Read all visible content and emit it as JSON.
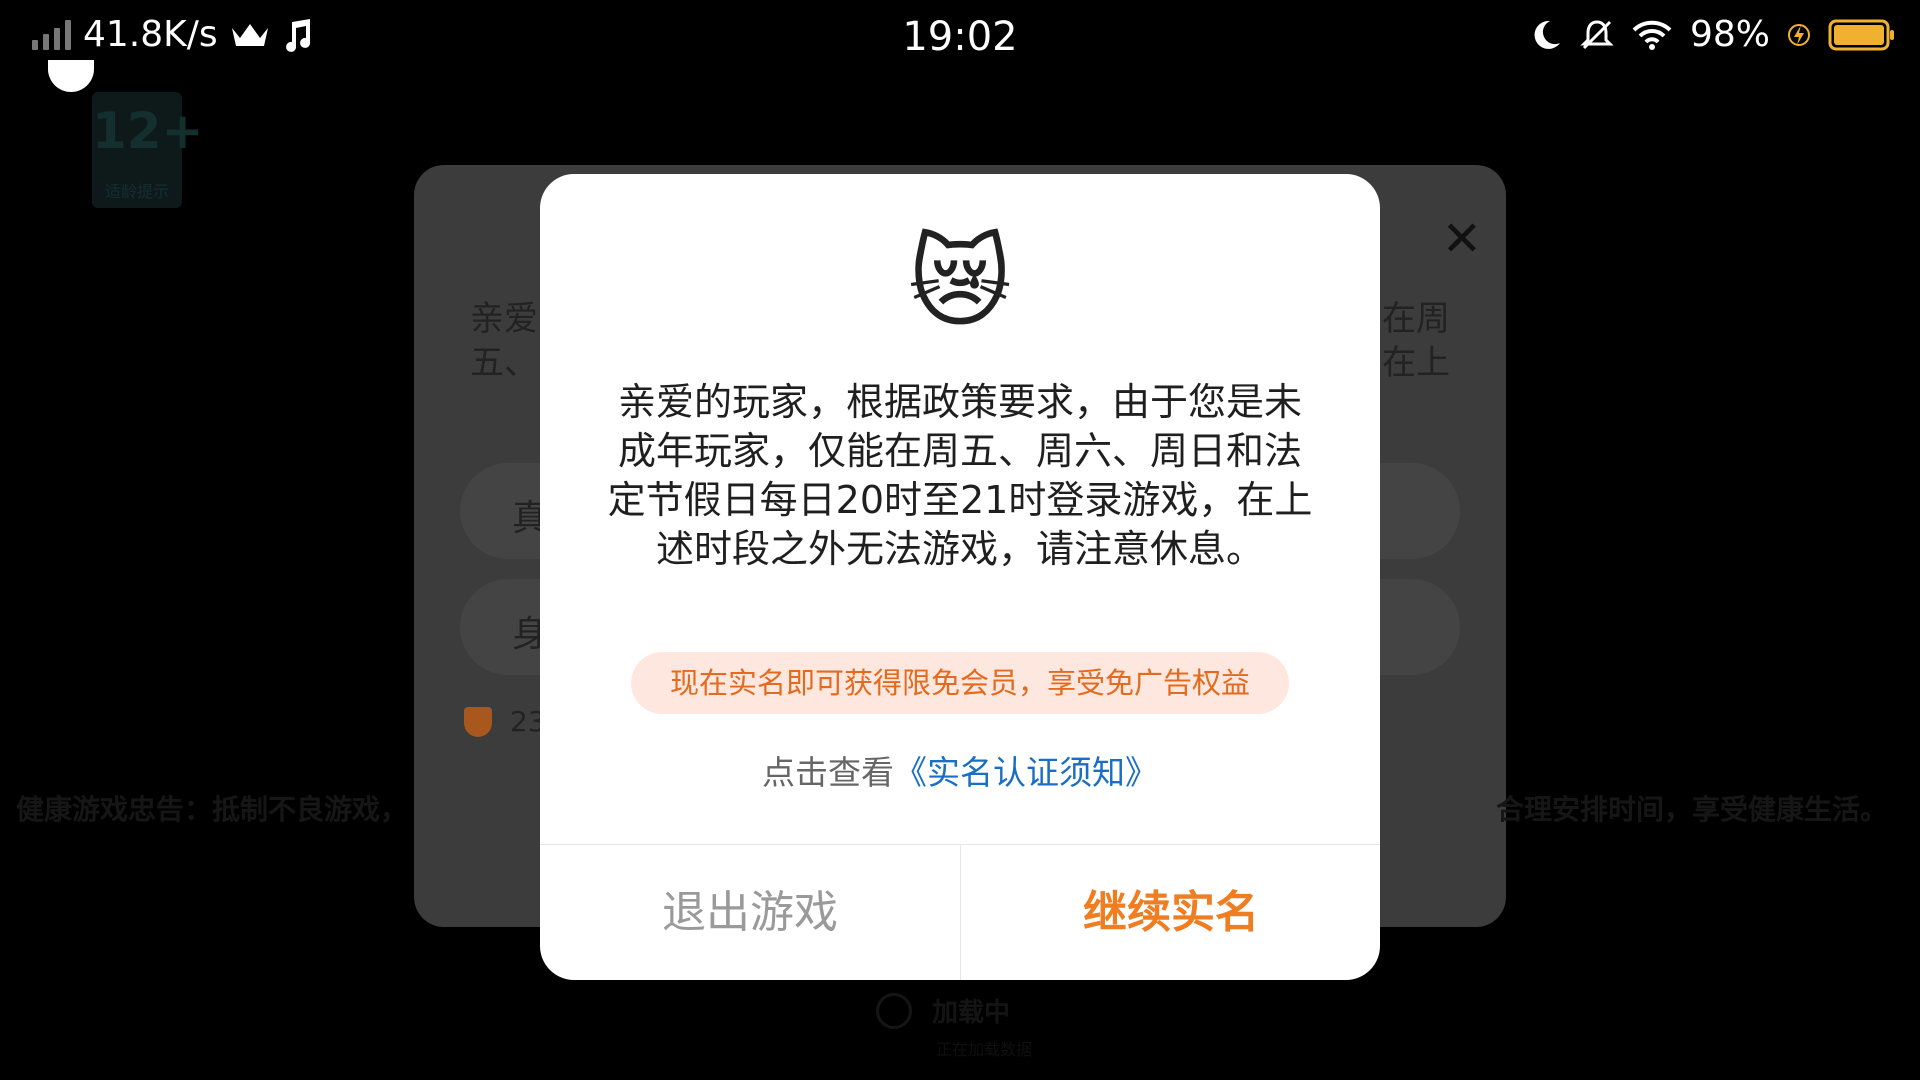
{
  "status_bar": {
    "speed": "41.8K/s",
    "time": "19:02",
    "battery": "98%",
    "icons": [
      "signal-icon",
      "crown-icon",
      "music-note-icon",
      "moon-icon",
      "muted-bell-icon",
      "wifi-icon",
      "charging-bolt-icon",
      "battery-icon"
    ]
  },
  "age_badge": {
    "rating": "12+",
    "label": "适龄提示"
  },
  "background_dialog": {
    "text_left_1": "亲爱",
    "text_left_2": "五、",
    "text_right_1": "在周",
    "text_right_2": "在上",
    "field1_prefix": "真",
    "field2_prefix": "身",
    "number_prefix": "23"
  },
  "health_notice": {
    "left": "健康游戏忠告：抵制不良游戏，",
    "right": "合理安排时间，享受健康生活。"
  },
  "loading": {
    "title": "加载中",
    "subtitle": "正在加载数据"
  },
  "modal": {
    "emoji": "😿",
    "message": "亲爱的玩家，根据政策要求，由于您是未成年玩家，仅能在周五、周六、周日和法定节假日每日20时至21时登录游戏，在上述时段之外无法游戏，请注意休息。",
    "promo": "现在实名即可获得限免会员，享受免广告权益",
    "notice_prefix": "点击查看",
    "notice_link": "《实名认证须知》",
    "exit_button": "退出游戏",
    "continue_button": "继续实名"
  },
  "colors": {
    "accent": "#ef7d22",
    "link": "#1a6fc4",
    "promo_bg": "#fde7de"
  }
}
